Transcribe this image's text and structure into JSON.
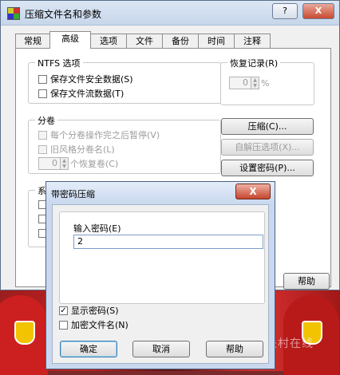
{
  "main_window": {
    "title": "压缩文件名和参数",
    "help_btn": "?",
    "close_btn": "X",
    "tabs": [
      "常规",
      "高级",
      "选项",
      "文件",
      "备份",
      "时间",
      "注释"
    ],
    "active_tab": "高级",
    "ntfs_group": {
      "legend": "NTFS 选项",
      "save_security": "保存文件安全数据(S)",
      "save_streams": "保存文件流数据(T)"
    },
    "recovery_group": {
      "legend": "恢复记录(R)",
      "value": "0",
      "unit": "%"
    },
    "volume_group": {
      "legend": "分卷",
      "pause_each": "每个分卷操作完之后暂停(V)",
      "old_style_names": "旧风格分卷名(L)",
      "recovery_volumes_value": "0",
      "recovery_volumes_label": "个恢复卷(C)"
    },
    "system_group_legend": "系",
    "buttons": {
      "compression": "压缩(C)...",
      "sfx_options": "自解压选项(X)...",
      "set_password": "设置密码(P)...",
      "help": "帮助"
    }
  },
  "password_dialog": {
    "title": "带密码压缩",
    "close_btn": "X",
    "input_label": "输入密码(E)",
    "input_value": "2",
    "show_password": "显示密码(S)",
    "show_password_checked": true,
    "encrypt_names": "加密文件名(N)",
    "encrypt_names_checked": false,
    "ok": "确定",
    "cancel": "取消",
    "help": "帮助"
  },
  "watermark": "中关村在线"
}
